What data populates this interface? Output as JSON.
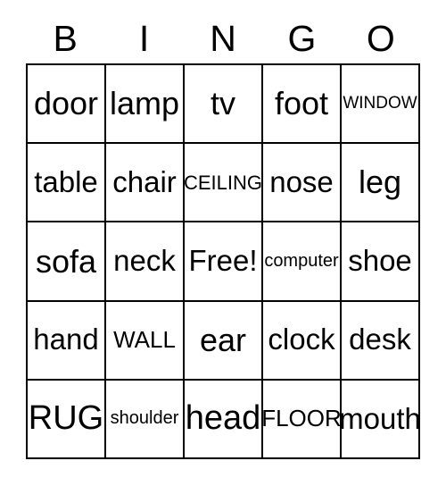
{
  "card": {
    "title": "BINGO",
    "header_letters": [
      "B",
      "I",
      "N",
      "G",
      "O"
    ],
    "free_space_label": "Free!",
    "colors": {
      "background": "#ffffff",
      "text": "#000000",
      "grid_line": "#000000"
    },
    "grid": {
      "columns": 5,
      "rows": 5,
      "cells": [
        [
          {
            "label": "door",
            "size": "lg"
          },
          {
            "label": "lamp",
            "size": "lg"
          },
          {
            "label": "tv",
            "size": "lg"
          },
          {
            "label": "foot",
            "size": "lg"
          },
          {
            "label": "WINDOW",
            "size": "tiny"
          }
        ],
        [
          {
            "label": "table",
            "size": "md"
          },
          {
            "label": "chair",
            "size": "md"
          },
          {
            "label": "CEILING",
            "size": "xs"
          },
          {
            "label": "nose",
            "size": "md"
          },
          {
            "label": "leg",
            "size": "lg"
          }
        ],
        [
          {
            "label": "sofa",
            "size": "lg"
          },
          {
            "label": "neck",
            "size": "md"
          },
          {
            "label": "Free!",
            "size": "md"
          },
          {
            "label": "computer",
            "size": "xxs"
          },
          {
            "label": "shoe",
            "size": "md"
          }
        ],
        [
          {
            "label": "hand",
            "size": "md"
          },
          {
            "label": "WALL",
            "size": "sm"
          },
          {
            "label": "ear",
            "size": "lg"
          },
          {
            "label": "clock",
            "size": "md"
          },
          {
            "label": "desk",
            "size": "md"
          }
        ],
        [
          {
            "label": "RUG",
            "size": "xl"
          },
          {
            "label": "shoulder",
            "size": "xxs"
          },
          {
            "label": "head",
            "size": "xl"
          },
          {
            "label": "FLOOR",
            "size": "sm"
          },
          {
            "label": "mouth",
            "size": "md"
          }
        ]
      ]
    }
  }
}
